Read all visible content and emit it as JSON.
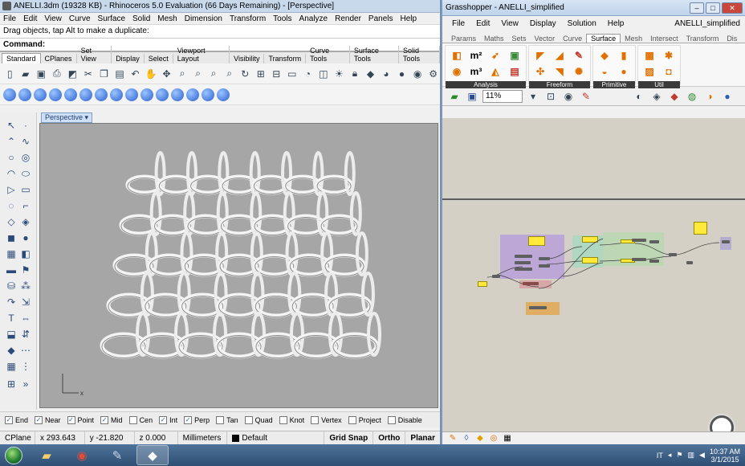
{
  "rhino": {
    "title": "ANELLI.3dm (19328 KB) - Rhinoceros 5.0 Evaluation (66 Days Remaining) - [Perspective]",
    "menu": [
      "File",
      "Edit",
      "View",
      "Curve",
      "Surface",
      "Solid",
      "Mesh",
      "Dimension",
      "Transform",
      "Tools",
      "Analyze",
      "Render",
      "Panels",
      "Help"
    ],
    "command_history": "Drag objects, tap Alt to make a duplicate:",
    "command_prompt": "Command:",
    "toolbar_tabs": [
      "Standard",
      "CPlanes",
      "Set View",
      "Display",
      "Select",
      "Viewport Layout",
      "Visibility",
      "Transform",
      "Curve Tools",
      "Surface Tools",
      "Solid Tools"
    ],
    "viewport_label": "Perspective",
    "axis_x": "x",
    "osnaps": [
      {
        "label": "End",
        "checked": true
      },
      {
        "label": "Near",
        "checked": true
      },
      {
        "label": "Point",
        "checked": true
      },
      {
        "label": "Mid",
        "checked": true
      },
      {
        "label": "Cen",
        "checked": false
      },
      {
        "label": "Int",
        "checked": true
      },
      {
        "label": "Perp",
        "checked": true
      },
      {
        "label": "Tan",
        "checked": false
      },
      {
        "label": "Quad",
        "checked": false
      },
      {
        "label": "Knot",
        "checked": false
      },
      {
        "label": "Vertex",
        "checked": false
      },
      {
        "label": "Project",
        "checked": false
      },
      {
        "label": "Disable",
        "checked": false
      }
    ],
    "status": {
      "cplane": "CPlane",
      "x": "x 293.643",
      "y": "y -21.820",
      "z": "z 0.000",
      "units": "Millimeters",
      "layer": "Default",
      "grid_snap": "Grid Snap",
      "ortho": "Ortho",
      "planar": "Planar"
    }
  },
  "grasshopper": {
    "title": "Grasshopper - ANELLI_simplified",
    "menu": [
      "File",
      "Edit",
      "View",
      "Display",
      "Solution",
      "Help"
    ],
    "document_name": "ANELLI_simplified",
    "tabs": [
      "Params",
      "Maths",
      "Sets",
      "Vector",
      "Curve",
      "Surface",
      "Mesh",
      "Intersect",
      "Transform",
      "Dis"
    ],
    "active_tab": "Surface",
    "groups": [
      "Analysis",
      "Freeform",
      "Primitive",
      "Util"
    ],
    "zoom": "11%"
  },
  "taskbar": {
    "language": "IT",
    "time": "10:37 AM",
    "date": "3/1/2015"
  }
}
